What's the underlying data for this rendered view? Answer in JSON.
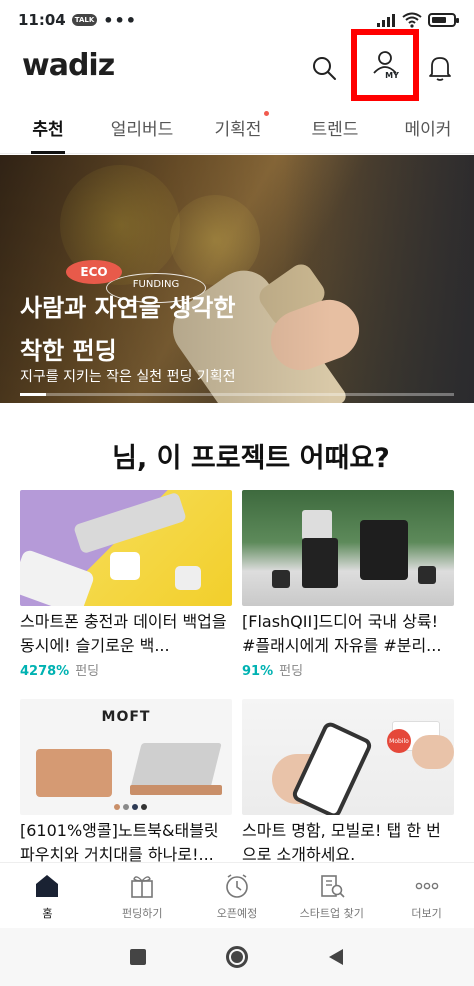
{
  "status_bar": {
    "time": "11:04",
    "talk_badge": "TALK",
    "dots": "•••"
  },
  "header": {
    "logo": "wadiz",
    "my_label": "MY"
  },
  "tabs": [
    {
      "label": "추천",
      "active": true
    },
    {
      "label": "얼리버드",
      "active": false
    },
    {
      "label": "기획전",
      "active": false,
      "dot": true
    },
    {
      "label": "트렌드",
      "active": false
    },
    {
      "label": "메이커",
      "active": false
    }
  ],
  "banner": {
    "eco_tag": "ECO",
    "funding_tag": "FUNDING",
    "title_line1": "사람과 자연을 생각한",
    "title_line2": "착한 펀딩",
    "subtitle": "지구를 지키는 작은 실천 펀딩 기획전",
    "progress": 0.06
  },
  "section": {
    "title": "님, 이 프로젝트 어때요?"
  },
  "cards": [
    {
      "title": "스마트폰 충전과 데이터 백업을 동시에! 슬기로운 백...",
      "percent": "4278%",
      "status": "펀딩"
    },
    {
      "title": "[FlashQII]드디어 국내 상륙! #플래시에게 자유를 #분리...",
      "percent": "91%",
      "status": "펀딩"
    },
    {
      "title": "[6101%앵콜]노트북&태블릿 파우치와 거치대를 하나로!...",
      "image_text": "MOFT"
    },
    {
      "title": "스마트 명함, 모빌로! 탭 한 번으로 소개하세요.",
      "image_text": "Mobilo"
    }
  ],
  "bottom_nav": [
    {
      "label": "홈",
      "icon": "home-icon",
      "active": true
    },
    {
      "label": "펀딩하기",
      "icon": "gift-icon",
      "active": false
    },
    {
      "label": "오픈예정",
      "icon": "clock-icon",
      "active": false
    },
    {
      "label": "스타트업 찾기",
      "icon": "building-search-icon",
      "active": false
    },
    {
      "label": "더보기",
      "icon": "more-icon",
      "active": false
    }
  ],
  "colors": {
    "accent_teal": "#00b2b2",
    "highlight_red": "#ff0000",
    "tab_dot": "#f15a4e"
  }
}
